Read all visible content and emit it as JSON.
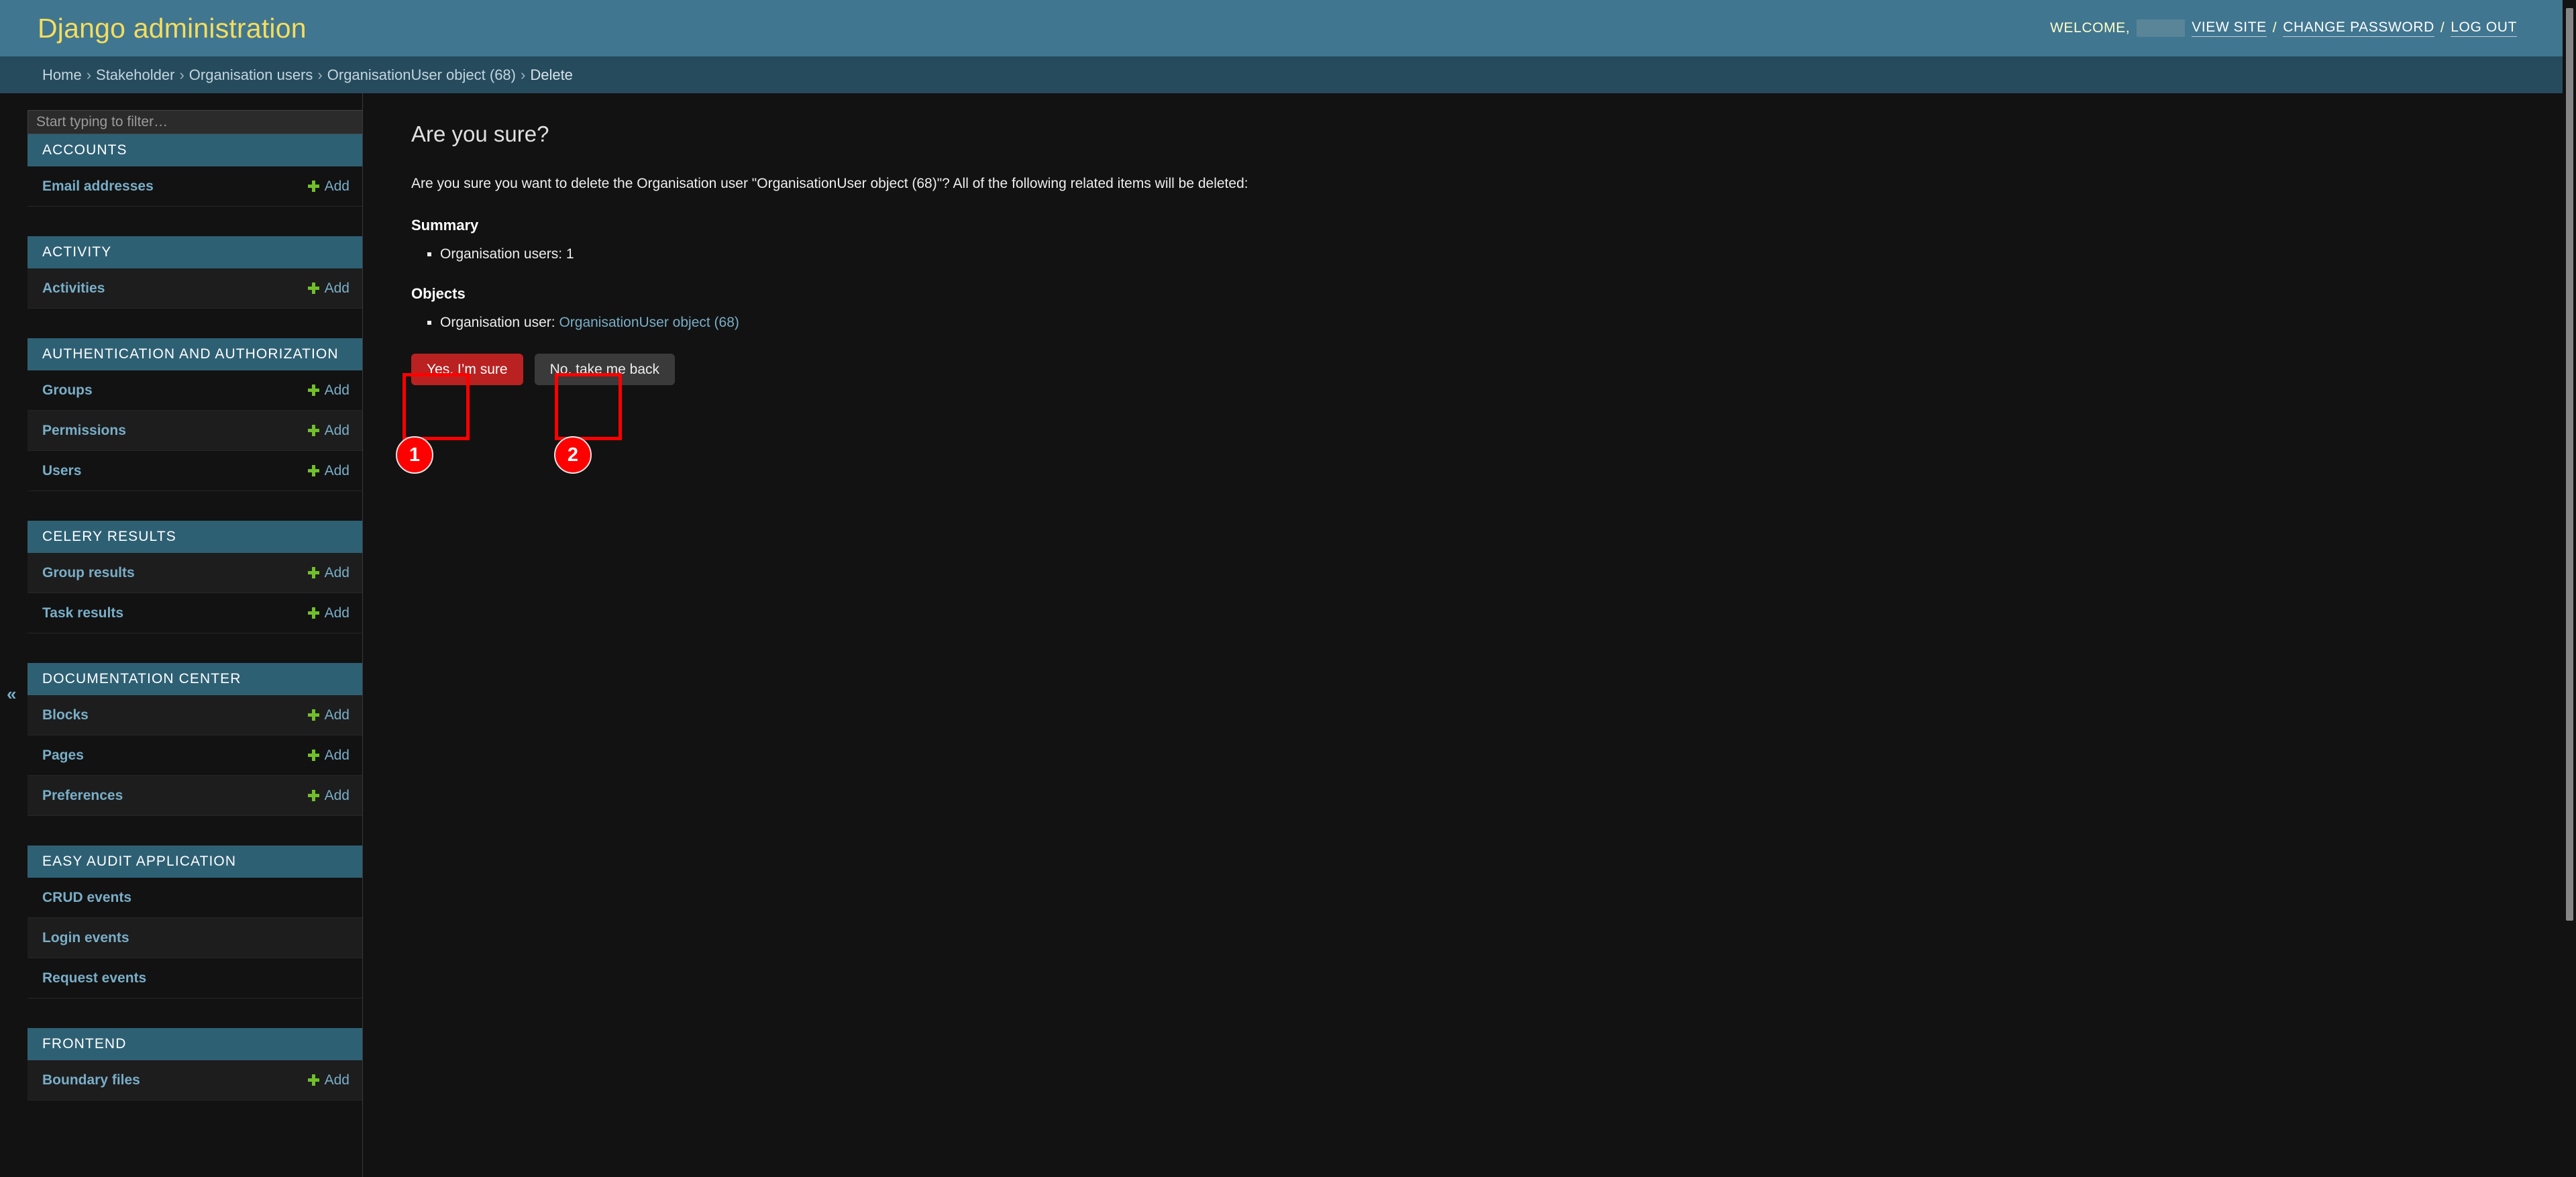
{
  "header": {
    "site_title": "Django administration",
    "welcome_label": "WELCOME,",
    "username_redacted": "",
    "links": {
      "view_site": "VIEW SITE",
      "change_password": "CHANGE PASSWORD",
      "log_out": "LOG OUT",
      "separator": "/"
    },
    "colors": {
      "header_bg": "#417690",
      "title_color": "#f5dd5d",
      "breadcrumb_bg": "#264b5d"
    }
  },
  "breadcrumbs": {
    "separator": "›",
    "items": [
      {
        "label": "Home",
        "link": true
      },
      {
        "label": "Stakeholder",
        "link": true
      },
      {
        "label": "Organisation users",
        "link": true
      },
      {
        "label": "OrganisationUser object (68)",
        "link": true
      },
      {
        "label": "Delete",
        "link": false
      }
    ]
  },
  "sidebar": {
    "filter_placeholder": "Start typing to filter…",
    "filter_value": "",
    "collapse_toggle": "«",
    "add_label": "Add",
    "modules": [
      {
        "caption": "ACCOUNTS",
        "models": [
          {
            "name": "Email addresses",
            "add": true
          }
        ]
      },
      {
        "caption": "ACTIVITY",
        "models": [
          {
            "name": "Activities",
            "add": true
          }
        ]
      },
      {
        "caption": "AUTHENTICATION AND AUTHORIZATION",
        "models": [
          {
            "name": "Groups",
            "add": true
          },
          {
            "name": "Permissions",
            "add": true
          },
          {
            "name": "Users",
            "add": true
          }
        ]
      },
      {
        "caption": "CELERY RESULTS",
        "models": [
          {
            "name": "Group results",
            "add": true
          },
          {
            "name": "Task results",
            "add": true
          }
        ]
      },
      {
        "caption": "DOCUMENTATION CENTER",
        "models": [
          {
            "name": "Blocks",
            "add": true
          },
          {
            "name": "Pages",
            "add": true
          },
          {
            "name": "Preferences",
            "add": true
          }
        ]
      },
      {
        "caption": "EASY AUDIT APPLICATION",
        "models": [
          {
            "name": "CRUD events",
            "add": false
          },
          {
            "name": "Login events",
            "add": false
          },
          {
            "name": "Request events",
            "add": false
          }
        ]
      },
      {
        "caption": "FRONTEND",
        "models": [
          {
            "name": "Boundary files",
            "add": true
          }
        ]
      }
    ]
  },
  "main": {
    "title": "Are you sure?",
    "intro": "Are you sure you want to delete the Organisation user \"OrganisationUser object (68)\"? All of the following related items will be deleted:",
    "summary_heading": "Summary",
    "summary_items": [
      "Organisation users: 1"
    ],
    "objects_heading": "Objects",
    "object_items": [
      {
        "prefix": "Organisation user: ",
        "link_text": "OrganisationUser object (68)"
      }
    ],
    "confirm_button": "Yes, I’m sure",
    "cancel_button": "No, take me back"
  },
  "annotations": [
    {
      "number": "1",
      "target": "yes-im-sure-button"
    },
    {
      "number": "2",
      "target": "no-take-me-back-button"
    }
  ]
}
